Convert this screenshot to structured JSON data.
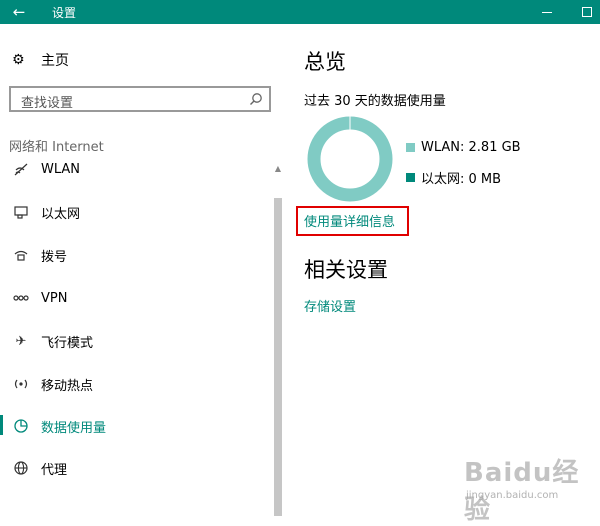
{
  "window": {
    "title": "设置",
    "back_icon": "back-arrow-icon"
  },
  "sidebar": {
    "home_label": "主页",
    "search_placeholder": "查找设置",
    "group_header": "网络和 Internet",
    "items": [
      {
        "label": "WLAN",
        "icon": "wifi-icon",
        "selected": false
      },
      {
        "label": "以太网",
        "icon": "ethernet-icon",
        "selected": false
      },
      {
        "label": "拨号",
        "icon": "dialup-icon",
        "selected": false
      },
      {
        "label": "VPN",
        "icon": "vpn-icon",
        "selected": false
      },
      {
        "label": "飞行模式",
        "icon": "airplane-icon",
        "selected": false
      },
      {
        "label": "移动热点",
        "icon": "hotspot-icon",
        "selected": false
      },
      {
        "label": "数据使用量",
        "icon": "data-usage-icon",
        "selected": true
      },
      {
        "label": "代理",
        "icon": "globe-icon",
        "selected": false
      }
    ]
  },
  "main": {
    "overview_title": "总览",
    "subtitle": "过去 30 天的数据使用量",
    "legend": [
      {
        "label": "WLAN: 2.81 GB",
        "color": "#80cbc4"
      },
      {
        "label": "以太网: 0 MB",
        "color": "#00897b"
      }
    ],
    "detail_link": "使用量详细信息",
    "related_title": "相关设置",
    "storage_link": "存储设置"
  },
  "chart_data": {
    "type": "pie",
    "categories": [
      "WLAN",
      "以太网"
    ],
    "values": [
      2.81,
      0
    ],
    "unit": "GB",
    "colors": [
      "#80cbc4",
      "#00897b"
    ]
  },
  "watermark": {
    "text": "Baidu经验",
    "sub": "jingyan.baidu.com"
  },
  "colors": {
    "accent": "#00897b",
    "highlight": "#e00000"
  }
}
